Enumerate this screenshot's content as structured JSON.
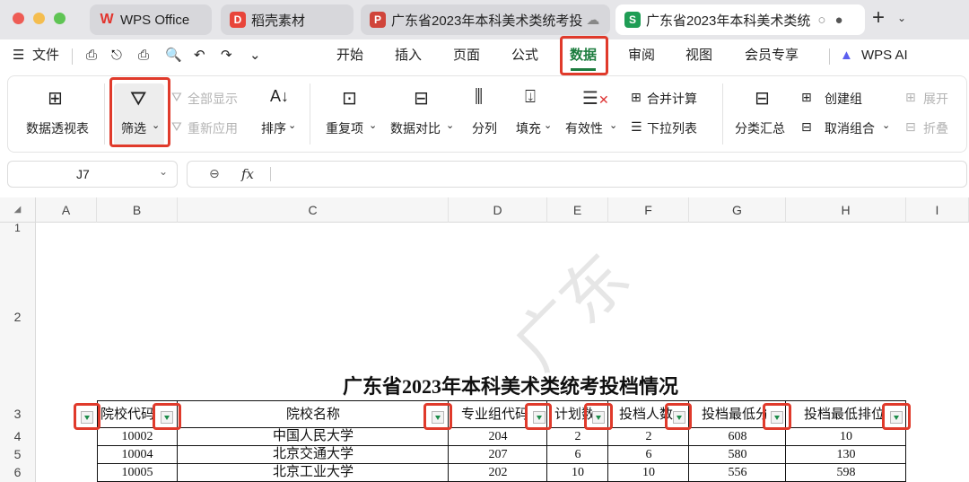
{
  "tabs": [
    {
      "label": "WPS Office"
    },
    {
      "label": "稻壳素材"
    },
    {
      "label": "广东省2023年本科美术类统考投"
    },
    {
      "label": "广东省2023年本科美术类统"
    }
  ],
  "new_tab": "+",
  "menu": {
    "file": "文件",
    "items": [
      "开始",
      "插入",
      "页面",
      "公式",
      "数据",
      "审阅",
      "视图",
      "会员专享"
    ],
    "wps_ai": "WPS AI"
  },
  "ribbon": {
    "pivot": "数据透视表",
    "filter": "筛选",
    "show_all": "全部显示",
    "reapply": "重新应用",
    "sort": "排序",
    "duplicates": "重复项",
    "compare": "数据对比",
    "split": "分列",
    "fill": "填充",
    "validity": "有效性",
    "merge_calc": "合并计算",
    "dropdown_list": "下拉列表",
    "subtotal": "分类汇总",
    "create_group": "创建组",
    "ungroup": "取消组合",
    "expand": "展开",
    "fold": "折叠"
  },
  "namebox": "J7",
  "fx": "fx",
  "columns": [
    "A",
    "B",
    "C",
    "D",
    "E",
    "F",
    "G",
    "H",
    "I"
  ],
  "rows": [
    "1",
    "2",
    "3",
    "4",
    "5",
    "6"
  ],
  "sheet": {
    "title": "广东省2023年本科美术类统考投档情况",
    "headers": [
      "院校代码",
      "院校名称",
      "专业组代码",
      "计划数",
      "投档人数",
      "投档最低分",
      "投档最低排位"
    ],
    "data": [
      [
        "10002",
        "中国人民大学",
        "204",
        "2",
        "2",
        "608",
        "10"
      ],
      [
        "10004",
        "北京交通大学",
        "207",
        "6",
        "6",
        "580",
        "130"
      ],
      [
        "10005",
        "北京工业大学",
        "202",
        "10",
        "10",
        "556",
        "598"
      ]
    ],
    "watermark": "广东"
  },
  "colors": {
    "highlight": "#e03a2b",
    "filter_arrow": "#1c8c4a"
  }
}
